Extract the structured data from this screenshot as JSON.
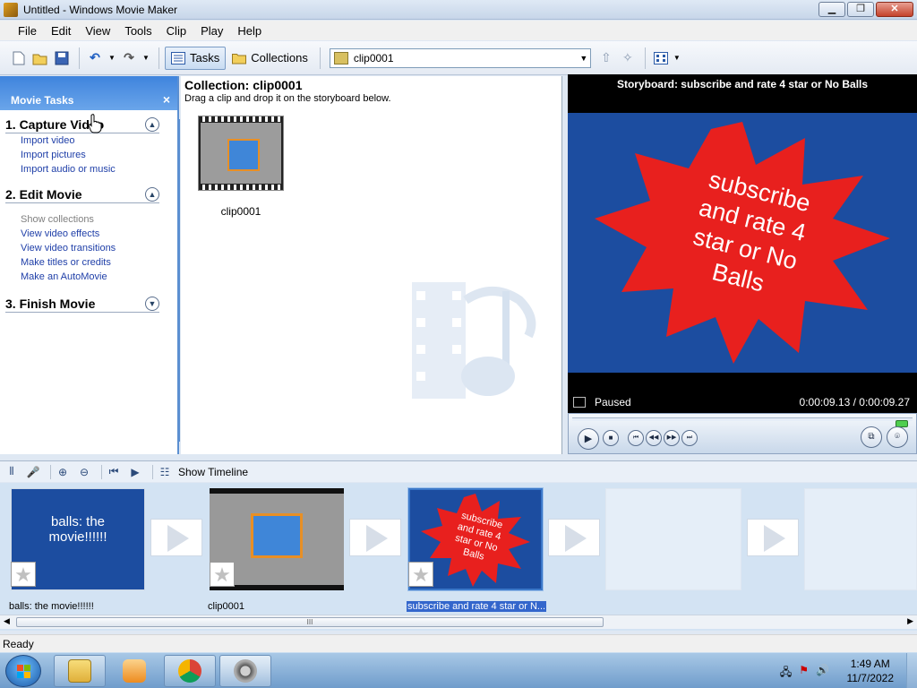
{
  "window": {
    "title": "Untitled - Windows Movie Maker",
    "controls": {
      "minimize": "▁",
      "maximize": "❐",
      "close": "✕"
    }
  },
  "menu": [
    "File",
    "Edit",
    "View",
    "Tools",
    "Clip",
    "Play",
    "Help"
  ],
  "toolbar": {
    "tasks_label": "Tasks",
    "collections_label": "Collections",
    "collection_value": "clip0001"
  },
  "task_pane": {
    "title": "Movie Tasks",
    "close": "×",
    "sections": [
      {
        "title": "1. Capture Video",
        "expanded": true,
        "links": [
          "Import video",
          "Import pictures",
          "Import audio or music"
        ]
      },
      {
        "title": "2. Edit Movie",
        "expanded": true,
        "links": [
          "Show collections",
          "View video effects",
          "View video transitions",
          "Make titles or credits",
          "Make an AutoMovie"
        ]
      },
      {
        "title": "3. Finish Movie",
        "expanded": false,
        "links": []
      }
    ]
  },
  "collection": {
    "title": "Collection: clip0001",
    "subtitle": "Drag a clip and drop it on the storyboard below.",
    "clips": [
      {
        "label": "clip0001"
      }
    ]
  },
  "monitor": {
    "title": "Storyboard: subscribe and rate 4 star or No Balls",
    "video_text": [
      "subscribe",
      "and rate 4",
      "star or No",
      "Balls"
    ],
    "status": "Paused",
    "time": "0:00:09.13 / 0:00:09.27",
    "progress": 0.985
  },
  "storyboard_toolbar": {
    "show_timeline": "Show Timeline"
  },
  "storyboard": {
    "items": [
      {
        "caption": "balls: the movie!!!!!!",
        "card_text": [
          "balls: the",
          "movie!!!!!!"
        ],
        "kind": "title"
      },
      {
        "caption": "clip0001",
        "kind": "clip"
      },
      {
        "caption": "subscribe and rate 4 star or N...",
        "card_text": [
          "subscribe",
          "and rate 4",
          "star or No",
          "Balls"
        ],
        "kind": "starburst",
        "selected": true
      }
    ],
    "scroll_grip": "III"
  },
  "statusbar": {
    "text": "Ready"
  },
  "taskbar": {
    "time": "1:49 AM",
    "date": "11/7/2022"
  },
  "colors": {
    "accent": "#3366cc",
    "video_bg": "#1c4da0",
    "starburst": "#e8201e"
  }
}
